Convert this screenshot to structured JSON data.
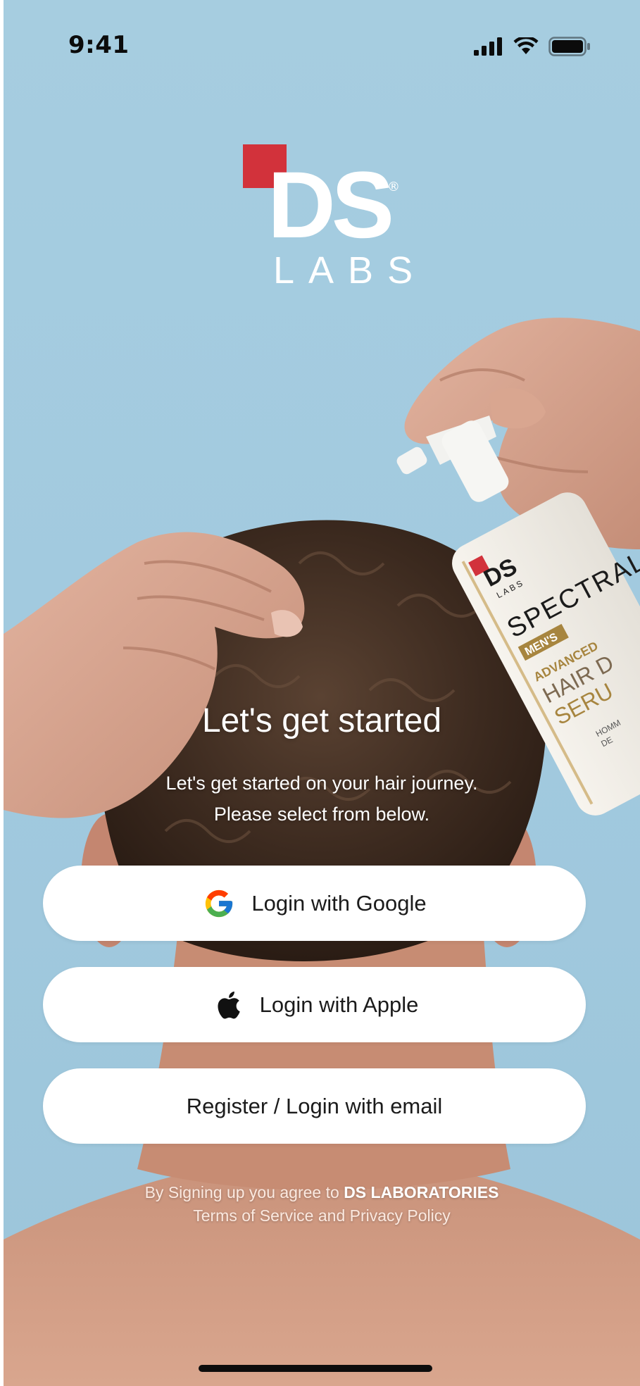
{
  "status_bar": {
    "time": "9:41"
  },
  "logo": {
    "mark": "DS",
    "registered": "®",
    "wordmark": "LABS"
  },
  "bottle": {
    "brand": "DS",
    "brand_sub": "LABS",
    "name": "SPECTRAL",
    "badge": "MEN'S",
    "line1": "ADVANCED",
    "line2": "HAIR D",
    "line3": "SERU",
    "small1": "HOMM",
    "small2": "DE"
  },
  "welcome": {
    "title": "Let's get started",
    "subtitle_line1": "Let's get started on your hair journey.",
    "subtitle_line2": "Please select from below."
  },
  "buttons": {
    "google": "Login with Google",
    "apple": "Login with Apple",
    "email": "Register / Login with email"
  },
  "legal": {
    "prefix": "By Signing up you agree to ",
    "company": "DS LABORATORIES",
    "line2": "Terms of Service and Privacy Policy"
  },
  "colors": {
    "background": "#a6cde0",
    "logo_red": "#d2323b",
    "button_bg": "#ffffff",
    "text_dark": "#1b1b1b"
  },
  "icons": [
    "cellular-signal-icon",
    "wifi-icon",
    "battery-icon",
    "google-icon",
    "apple-icon"
  ]
}
